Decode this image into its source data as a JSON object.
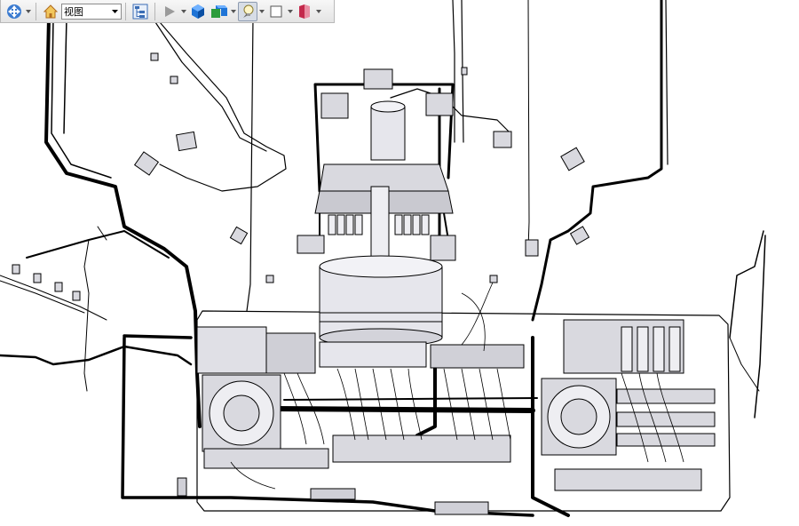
{
  "toolbar": {
    "view_select_value": "视图",
    "icons": [
      "move-icon",
      "home-icon",
      "view-select",
      "view-tree-icon",
      "play-icon",
      "shaded-cube-icon",
      "display-style-icon",
      "light-bulb-icon",
      "box-outline-icon",
      "section-icon"
    ]
  },
  "scene": {
    "description_kind": "3D CAD assembly model of electrical cabinet with wiring harnesses",
    "colors": {
      "line": "#000000",
      "part_fill": "#d9d9df",
      "part_fill_light": "#eeeef2",
      "background": "#ffffff"
    }
  }
}
